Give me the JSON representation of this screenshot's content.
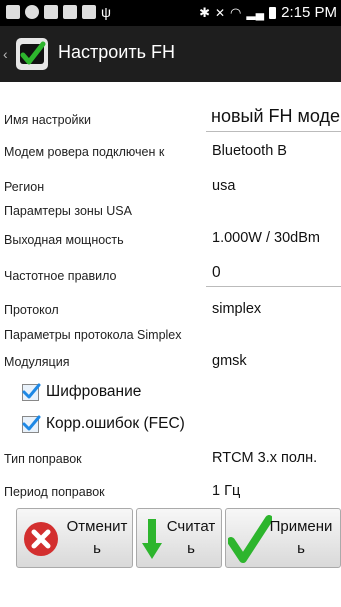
{
  "status": {
    "time": "2:15 PM"
  },
  "header": {
    "title": "Настроить FH"
  },
  "fields": [
    {
      "label": "Имя настройки",
      "value": "новый FH модем"
    },
    {
      "label": "Модем ровера подключен к",
      "value": "Bluetooth B"
    },
    {
      "label": "Регион",
      "value": "usa"
    },
    {
      "label": "Парамтеры зоны USA",
      "value": ""
    },
    {
      "label": "Выходная мощность",
      "value": "1.000W / 30dBm"
    },
    {
      "label": "Частотное правило",
      "value": "0"
    },
    {
      "label": "Протокол",
      "value": "simplex"
    },
    {
      "label": "Параметры протокола Simplex",
      "value": ""
    },
    {
      "label": "Модуляция",
      "value": "gmsk"
    }
  ],
  "checkboxes": [
    {
      "label": "Шифрование",
      "checked": true
    },
    {
      "label": "Корр.ошибок (FEC)",
      "checked": true
    }
  ],
  "fields2": [
    {
      "label": "Тип поправок",
      "value": "RTCM 3.x полн."
    },
    {
      "label": "Период поправок",
      "value": "1 Гц"
    }
  ],
  "buttons": [
    {
      "label_line1": "Отменит",
      "label_line2": "ь",
      "icon": "cancel-icon"
    },
    {
      "label_line1": "Считат",
      "label_line2": "ь",
      "icon": "download-arrow-icon"
    },
    {
      "label_line1": "Примени",
      "label_line2": "ь",
      "icon": "checkmark-icon"
    }
  ],
  "colors": {
    "accent_green": "#2db52d",
    "cancel_red": "#d32f2f",
    "check_blue": "#1e88e5"
  }
}
